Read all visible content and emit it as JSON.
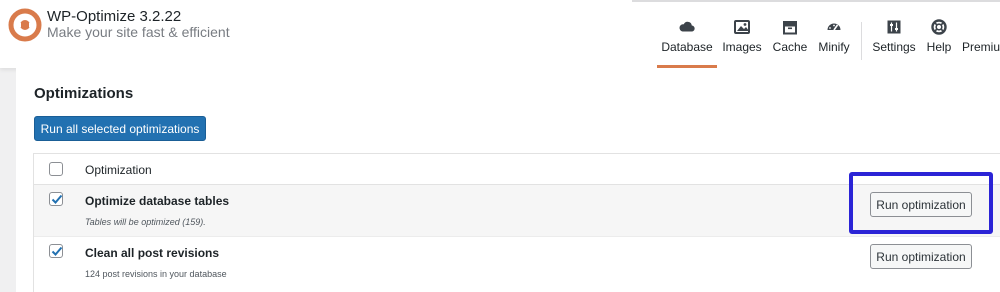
{
  "app": {
    "title": "WP-Optimize 3.2.22",
    "tagline": "Make your site fast & efficient",
    "logo_icon": "wp-optimize-logo-icon",
    "accent_color": "#d97b4b"
  },
  "nav": {
    "items": [
      {
        "label": "Database",
        "icon": "cloud-database-icon",
        "active": true
      },
      {
        "label": "Images",
        "icon": "images-icon",
        "active": false
      },
      {
        "label": "Cache",
        "icon": "cache-icon",
        "active": false
      },
      {
        "label": "Minify",
        "icon": "minify-icon",
        "active": false
      },
      {
        "label": "Settings",
        "icon": "settings-icon",
        "active": false
      },
      {
        "label": "Help",
        "icon": "help-icon",
        "active": false
      },
      {
        "label": "Premiu",
        "icon": "premium-icon",
        "active": false
      }
    ]
  },
  "main": {
    "section_title": "Optimizations",
    "run_all_label": "Run all selected optimizations",
    "primary_color": "#2271b1",
    "table": {
      "header_label": "Optimization",
      "rows": [
        {
          "title": "Optimize database tables",
          "description": "Tables will be optimized (159).",
          "checked": true,
          "button_label": "Run optimization",
          "highlighted": true
        },
        {
          "title": "Clean all post revisions",
          "description": "124 post revisions in your database",
          "checked": true,
          "button_label": "Run optimization",
          "highlighted": false
        }
      ]
    }
  },
  "highlight_color": "#2b24d6"
}
